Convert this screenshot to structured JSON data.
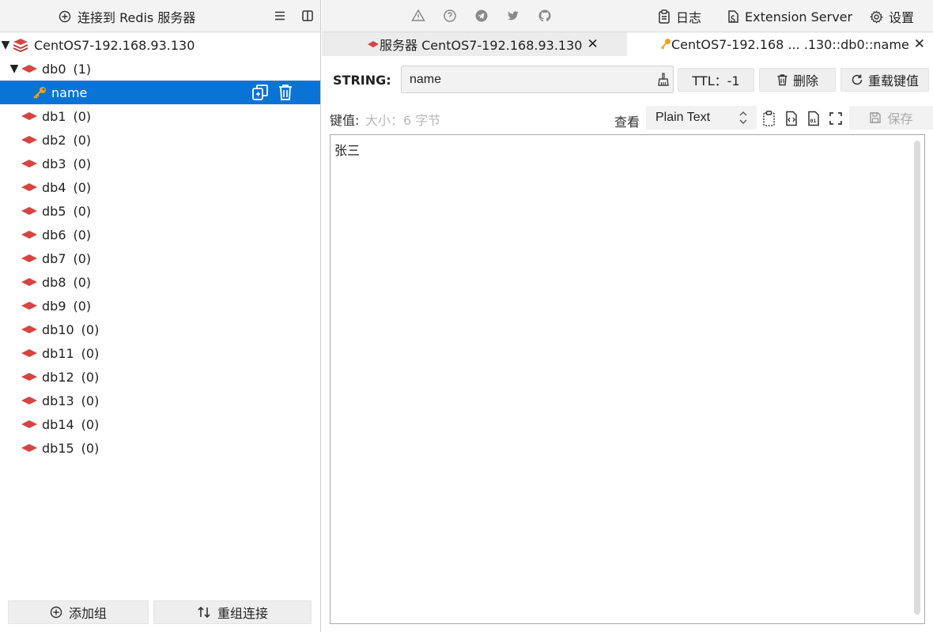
{
  "left_toolbar": {
    "connect_label": "连接到 Redis 服务器"
  },
  "server": {
    "name": "CentOS7-192.168.93.130"
  },
  "databases": [
    {
      "name": "db0",
      "count": "(1)",
      "expanded": true
    },
    {
      "name": "db1",
      "count": "(0)"
    },
    {
      "name": "db2",
      "count": "(0)"
    },
    {
      "name": "db3",
      "count": "(0)"
    },
    {
      "name": "db4",
      "count": "(0)"
    },
    {
      "name": "db5",
      "count": "(0)"
    },
    {
      "name": "db6",
      "count": "(0)"
    },
    {
      "name": "db7",
      "count": "(0)"
    },
    {
      "name": "db8",
      "count": "(0)"
    },
    {
      "name": "db9",
      "count": "(0)"
    },
    {
      "name": "db10",
      "count": "(0)"
    },
    {
      "name": "db11",
      "count": "(0)"
    },
    {
      "name": "db12",
      "count": "(0)"
    },
    {
      "name": "db13",
      "count": "(0)"
    },
    {
      "name": "db14",
      "count": "(0)"
    },
    {
      "name": "db15",
      "count": "(0)"
    }
  ],
  "selected_key": {
    "name": "name"
  },
  "left_footer": {
    "add_group": "添加组",
    "regroup": "重组连接"
  },
  "right_toolbar": {
    "log": "日志",
    "extension": "Extension Server",
    "settings": "设置"
  },
  "tabs": [
    {
      "label": "服务器 CentOS7-192.168.93.130",
      "icon": "server-icon"
    },
    {
      "label": "CentOS7-192.168 ... .130::db0::name",
      "icon": "key-icon",
      "active": true
    }
  ],
  "key_editor": {
    "type": "STRING:",
    "key_name": "name",
    "ttl": "TTL：-1",
    "delete": "删除",
    "reload": "重载键值",
    "value_label": "键值:",
    "size": "大小：6 字节",
    "view_label": "查看",
    "format": "Plain Text",
    "save": "保存",
    "value": "张三"
  },
  "colors": {
    "accent": "#0a73d6",
    "redis_red": "#d64541",
    "key_orange": "#f0a020"
  }
}
